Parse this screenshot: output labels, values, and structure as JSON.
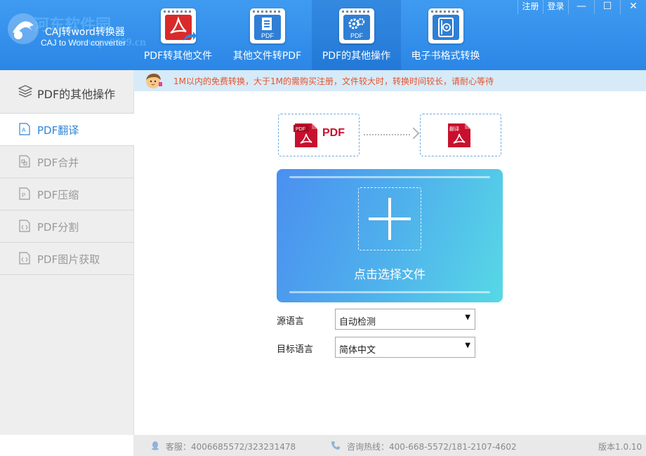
{
  "app": {
    "title": "CAJ转word转换器",
    "subtitle": "CAJ to Word converter",
    "watermark": "河东软件园",
    "watermark_url": "www.pc0359.cn"
  },
  "window_controls": {
    "register": "注册",
    "login": "登录",
    "minimize": "—",
    "maximize": "☐",
    "close": "✕"
  },
  "nav": {
    "tabs": [
      {
        "label": "PDF转其他文件",
        "icon": "pdf-acrobat-icon"
      },
      {
        "label": "其他文件转PDF",
        "icon": "document-to-pdf-icon",
        "badge": "PDF"
      },
      {
        "label": "PDF的其他操作",
        "icon": "gear-pdf-icon",
        "badge": "PDF"
      },
      {
        "label": "电子书格式转换",
        "icon": "ebook-icon"
      }
    ],
    "active_index": 2
  },
  "notice": {
    "text": "1M以内的免费转换，大于1M的需购买注册，文件较大时，转换时间较长，请耐心等待"
  },
  "sidebar": {
    "header": "PDF的其他操作",
    "items": [
      {
        "label": "PDF翻译",
        "icon": "translate-icon"
      },
      {
        "label": "PDF合并",
        "icon": "merge-icon"
      },
      {
        "label": "PDF压缩",
        "icon": "compress-icon"
      },
      {
        "label": "PDF分割",
        "icon": "split-icon"
      },
      {
        "label": "PDF图片获取",
        "icon": "image-extract-icon"
      }
    ],
    "active_index": 0
  },
  "main": {
    "source_file": {
      "tag": "PDF",
      "label": "PDF"
    },
    "target_file": {
      "tag": "翻译"
    },
    "upload_label": "点击选择文件",
    "source_language": {
      "label": "源语言",
      "value": "自动检测"
    },
    "target_language": {
      "label": "目标语言",
      "value": "简体中文"
    }
  },
  "footer": {
    "service": "客服：4006685572/323231478",
    "hotline": "咨询热线：400-668-5572/181-2107-4602",
    "version": "版本1.0.10"
  },
  "colors": {
    "header_blue": "#2b86e6",
    "accent": "#2f86d8",
    "notice_text": "#e8522a",
    "pdf_red": "#c8102e"
  }
}
